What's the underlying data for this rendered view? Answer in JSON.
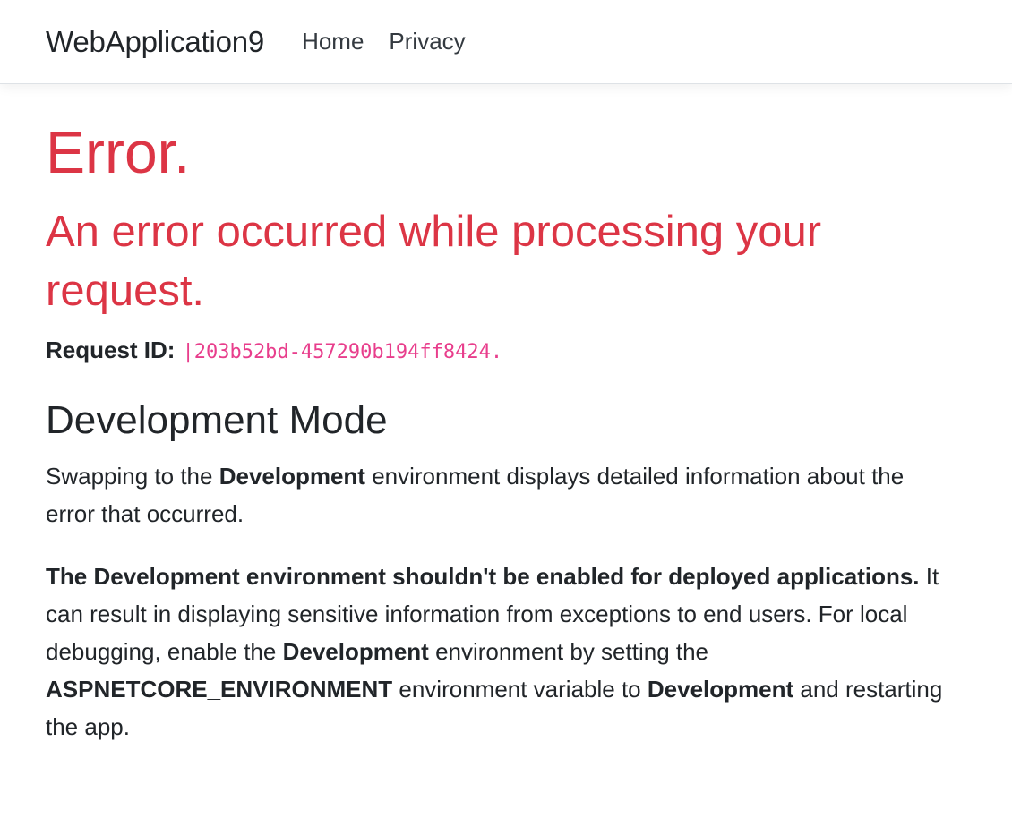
{
  "navbar": {
    "brand": "WebApplication9",
    "links": [
      "Home",
      "Privacy"
    ]
  },
  "error": {
    "title": "Error.",
    "subtitle": "An error occurred while processing your request.",
    "request_id_label": "Request ID:",
    "request_id_value": "|203b52bd-457290b194ff8424."
  },
  "dev_mode": {
    "heading": "Development Mode",
    "p1": {
      "t1": "Swapping to the ",
      "b1": "Development",
      "t2": " environment displays detailed information about the error that occurred."
    },
    "p2": {
      "b1": "The Development environment shouldn't be enabled for deployed applications.",
      "t1": " It can result in displaying sensitive information from exceptions to end users. For local debugging, enable the ",
      "b2": "Development",
      "t2": " environment by setting the ",
      "b3": "ASPNETCORE_ENVIRONMENT",
      "t3": " environment variable to ",
      "b4": "Development",
      "t4": " and restarting the app."
    }
  },
  "colors": {
    "danger": "#dc3545",
    "code": "#e83e8c",
    "text": "#212529"
  }
}
